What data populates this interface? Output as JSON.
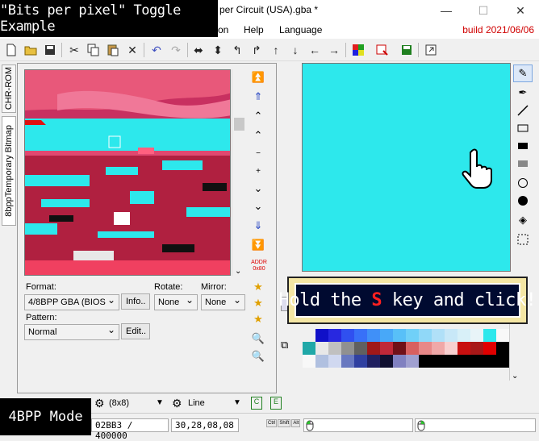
{
  "window": {
    "title_fragment": "per Circuit (USA).gba *",
    "minimize": "—",
    "maximize": "☐",
    "close": "✕"
  },
  "overlay": {
    "caption": "\"Bits per pixel\" Toggle Example",
    "mode_caption": "4BPP Mode",
    "hold_prefix": "Hold the ",
    "hold_key": "S",
    "hold_suffix": " key and click!"
  },
  "menu": {
    "items": [
      "on",
      "Help",
      "Language"
    ],
    "build": "build 2021/06/06"
  },
  "tabs": {
    "chr_rom": "CHR-ROM",
    "bitmap": "8bppTemporary Bitmap"
  },
  "left_panel": {
    "format_label": "Format:",
    "format_value": "4/8BPP GBA (BIOS",
    "info_button": "Info..",
    "rotate_label": "Rotate:",
    "rotate_value": "None",
    "mirror_label": "Mirror:",
    "mirror_value": "None",
    "pattern_label": "Pattern:",
    "pattern_value": "Normal",
    "edit_button": "Edit..",
    "addr_label": "ADDR\n0x80"
  },
  "bottom_tools": {
    "grid_size": "(8x8)",
    "draw_mode": "Line"
  },
  "status": {
    "address": "02BB3 / 400000",
    "coords": "30,28,08,08",
    "keys": [
      "Ctrl",
      "Shift",
      "Alt"
    ]
  },
  "colors": {
    "canvas": "#2de8ec",
    "build": "#d00000",
    "hold_key": "#ff2020"
  },
  "palette_rows": [
    [
      "#f0f0f0",
      "#1010c8",
      "#2828e0",
      "#3050f0",
      "#3870f8",
      "#4090f8",
      "#48a8f8",
      "#58c0f8",
      "#70d0f8",
      "#90d8f8",
      "#b0e0f8",
      "#c8e8f8",
      "#d8f0f8",
      "#e8f4f8",
      "#2de8ec",
      "#f8f8f8"
    ],
    [
      "#20a8a8",
      "#e8e8e8",
      "#c0c0c0",
      "#909090",
      "#606060",
      "#a01818",
      "#c02838",
      "#701018",
      "#d86060",
      "#e88888",
      "#f0a8a8",
      "#f8d0d0",
      "#c81010",
      "#a81818",
      "#e00000",
      "#000000"
    ],
    [
      "#f8f8f8",
      "#b0c0e0",
      "#d0d8f0",
      "#6878c0",
      "#3040a0",
      "#202060",
      "#101030",
      "#8080c0",
      "#a0a0d0",
      "#000000",
      "#000000",
      "#000000",
      "#000000",
      "#000000",
      "#000000",
      "#000000"
    ]
  ]
}
